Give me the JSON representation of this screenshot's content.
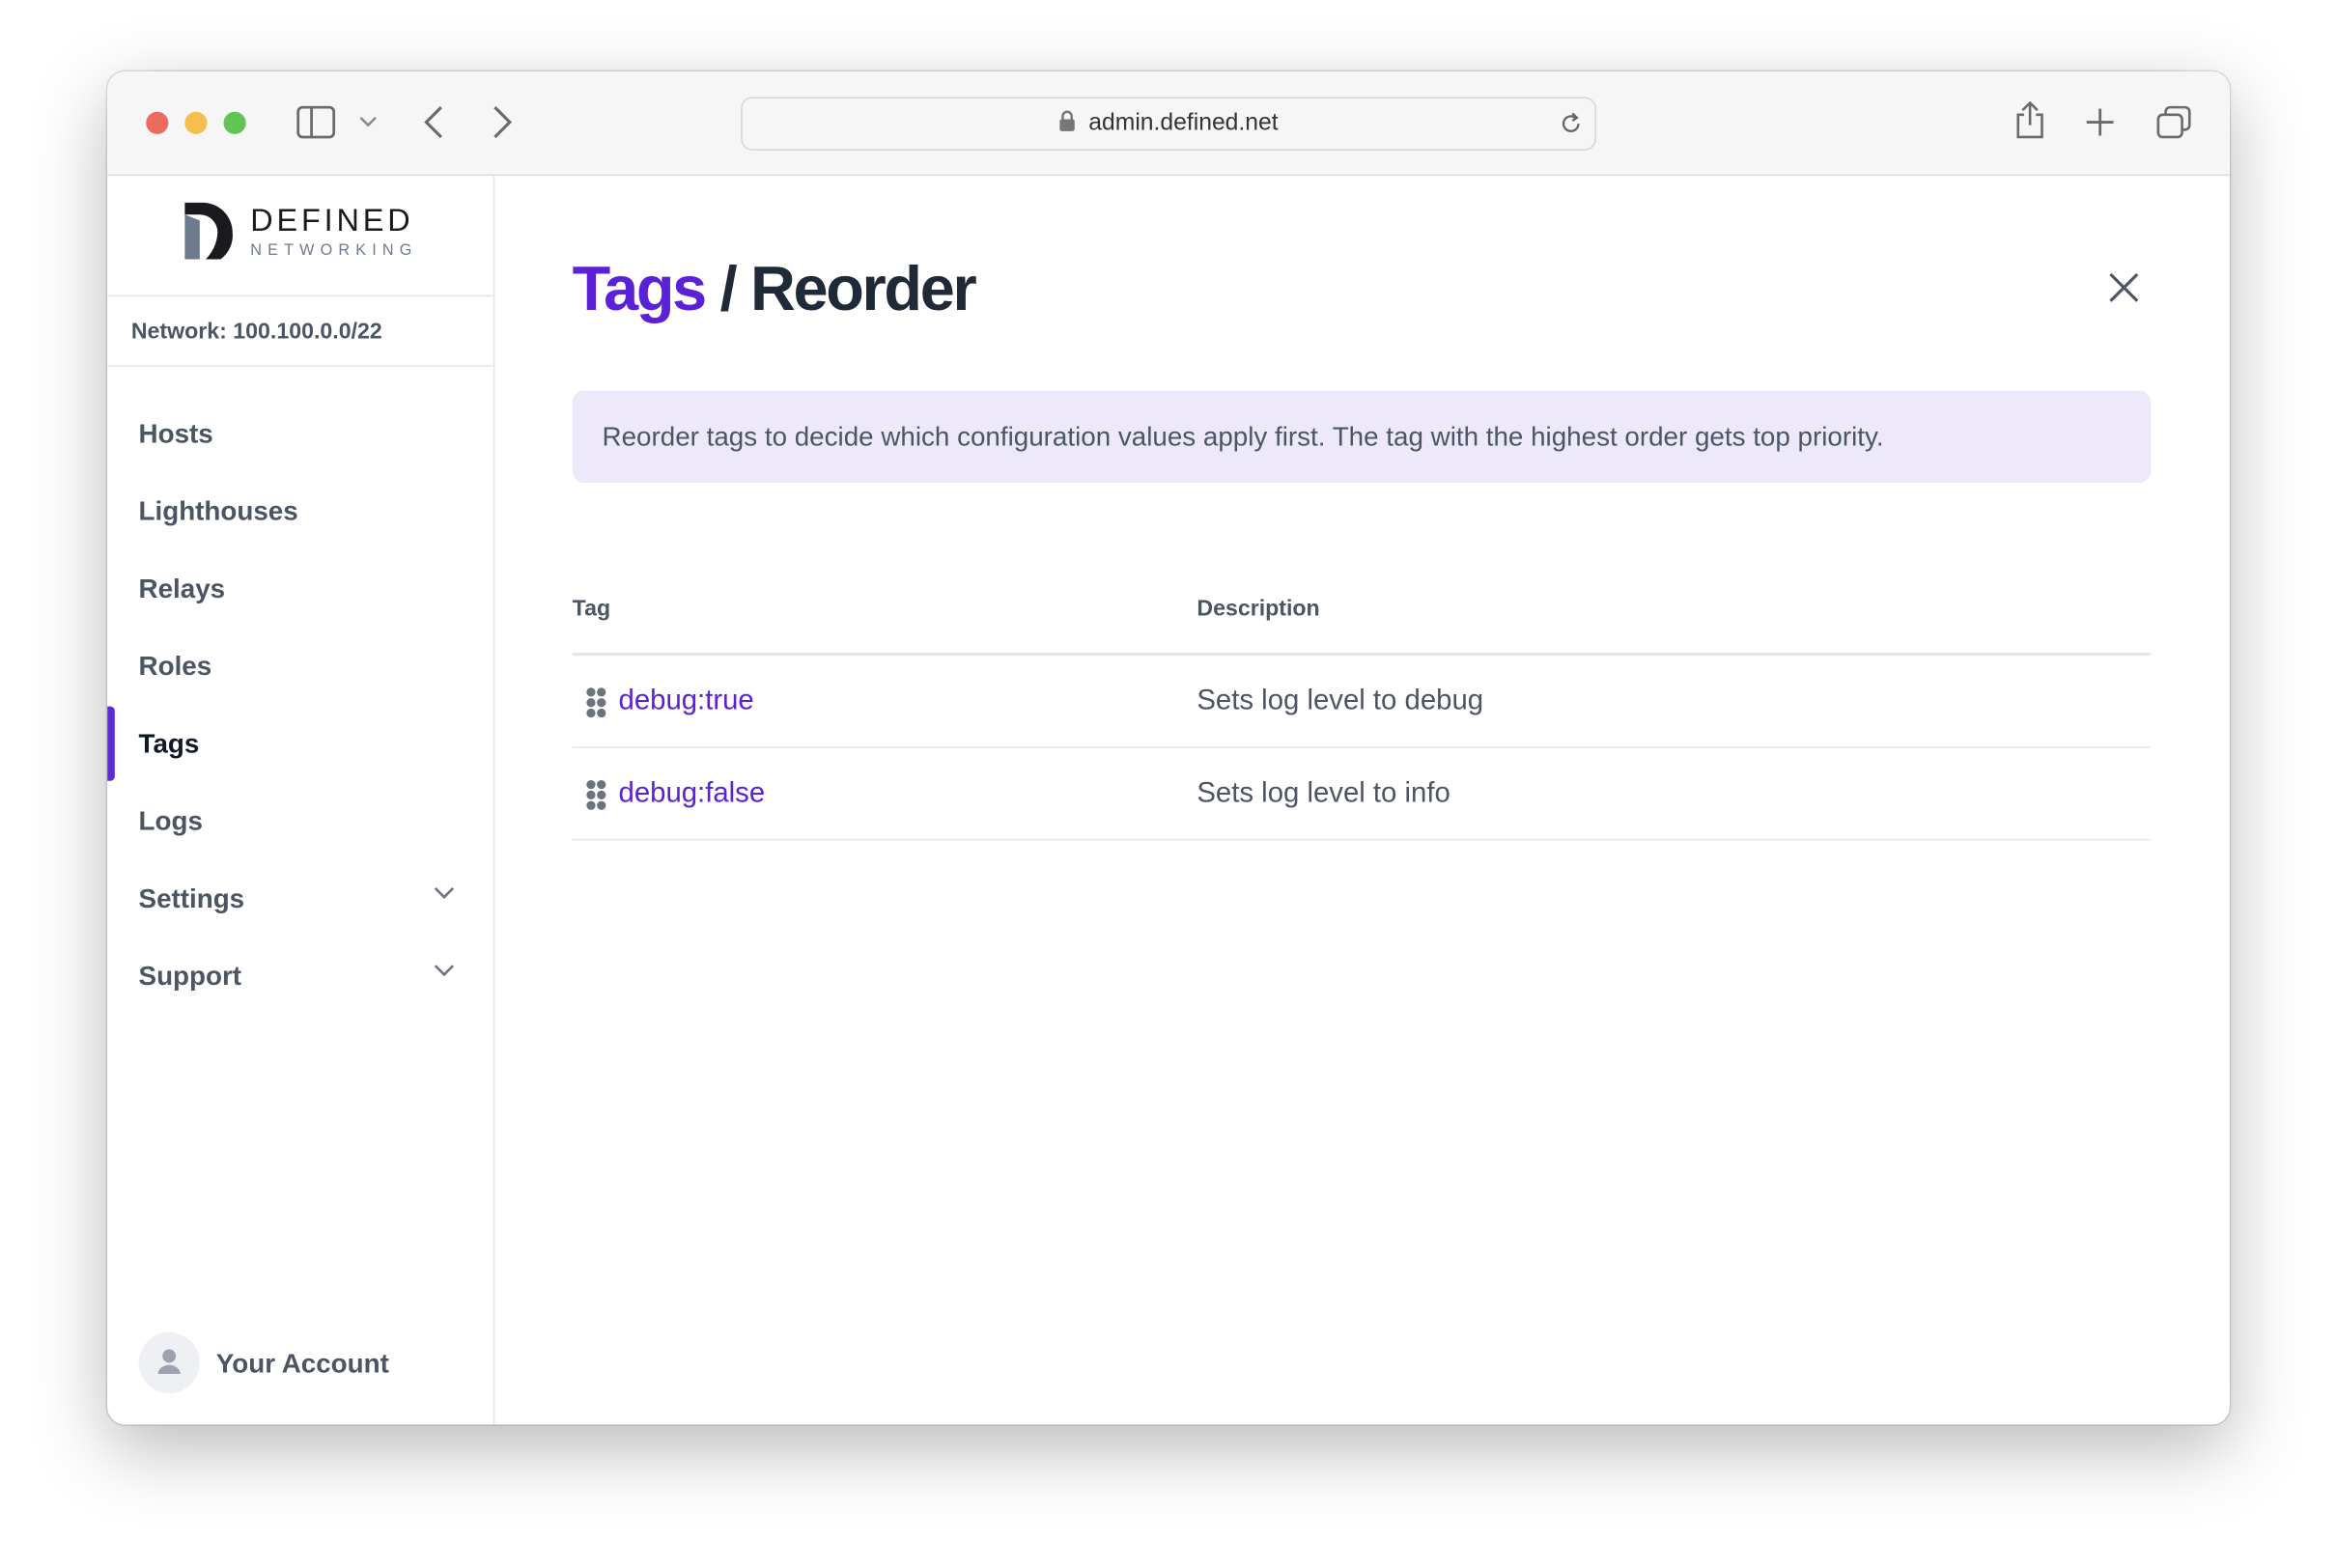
{
  "browser": {
    "url": "admin.defined.net",
    "colors": {
      "close": "#ec6a5e",
      "minimize": "#f4bf4f",
      "maximize": "#61c554"
    }
  },
  "logo": {
    "line1": "DEFINED",
    "line2": "NETWORKING"
  },
  "sidebar": {
    "network": "Network: 100.100.0.0/22",
    "items": [
      {
        "label": "Hosts"
      },
      {
        "label": "Lighthouses"
      },
      {
        "label": "Relays"
      },
      {
        "label": "Roles"
      },
      {
        "label": "Tags",
        "active": true
      },
      {
        "label": "Logs"
      },
      {
        "label": "Settings",
        "expandable": true
      },
      {
        "label": "Support",
        "expandable": true
      }
    ],
    "account": "Your Account"
  },
  "main": {
    "title_section": "Tags",
    "title_sep": " / ",
    "title_page": "Reorder",
    "info": "Reorder tags to decide which configuration values apply first. The tag with the highest order gets top priority.",
    "columns": [
      "Tag",
      "Description"
    ],
    "rows": [
      {
        "tag": "debug:true",
        "description": "Sets log level to debug"
      },
      {
        "tag": "debug:false",
        "description": "Sets log level to info"
      }
    ]
  },
  "accent": "#5b21d6"
}
